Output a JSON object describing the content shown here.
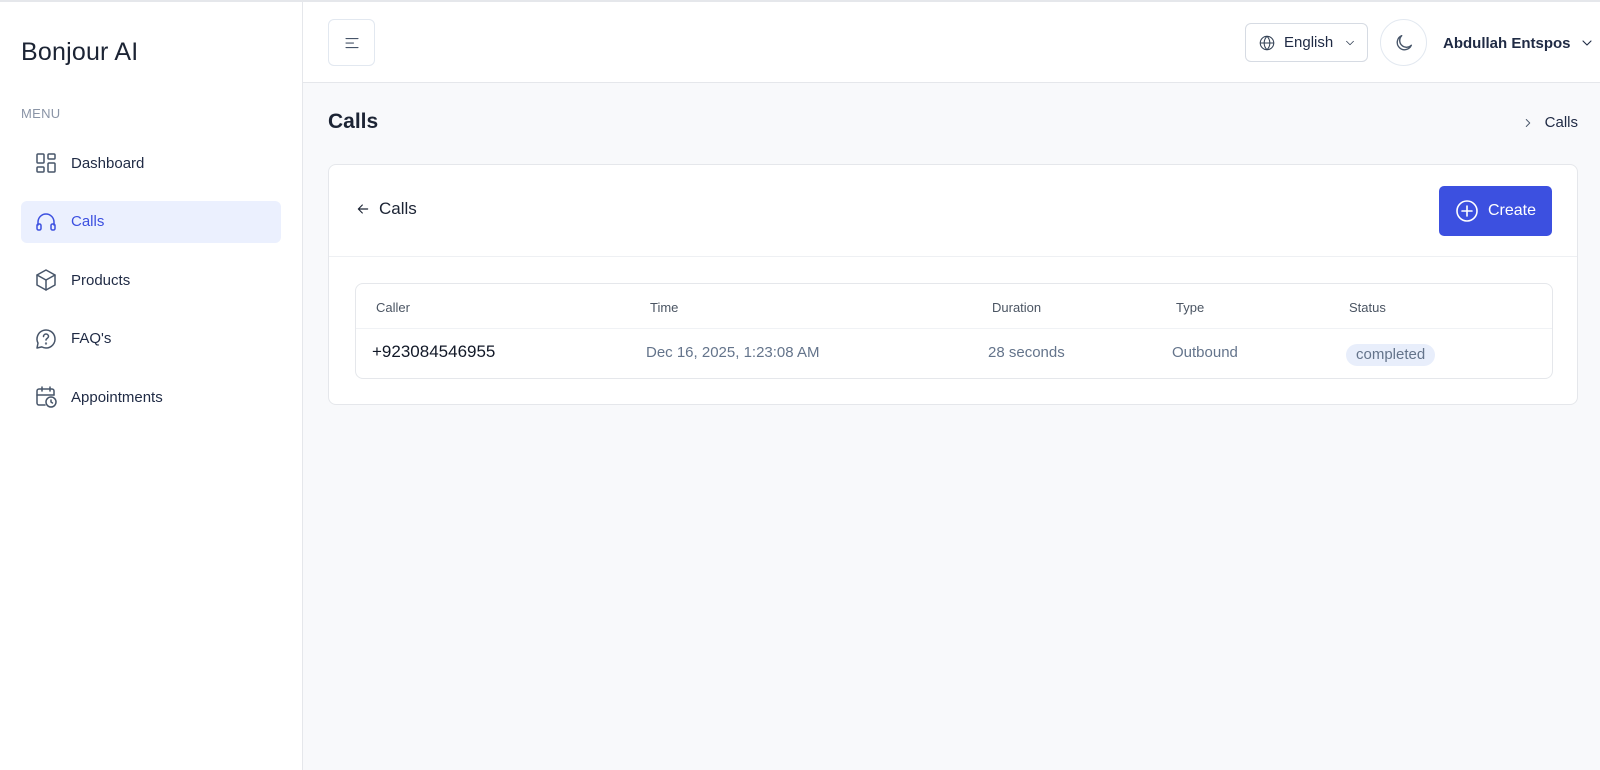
{
  "sidebar": {
    "brand": "Bonjour AI",
    "menu_label": "MENU",
    "items": [
      {
        "label": "Dashboard",
        "icon": "dashboard-grid-icon"
      },
      {
        "label": "Calls",
        "icon": "headset-icon",
        "active": true
      },
      {
        "label": "Products",
        "icon": "box-icon"
      },
      {
        "label": "FAQ's",
        "icon": "help-circle-icon"
      },
      {
        "label": "Appointments",
        "icon": "calendar-clock-icon"
      }
    ]
  },
  "header": {
    "language": "English",
    "user_name": "Abdullah Entspos"
  },
  "page": {
    "title": "Calls",
    "breadcrumb": "Calls"
  },
  "card": {
    "back_label": "Calls",
    "create_label": "Create"
  },
  "table": {
    "columns": [
      "Caller",
      "Time",
      "Duration",
      "Type",
      "Status"
    ],
    "rows": [
      {
        "caller": "+923084546955",
        "time": "Dec 16, 2025, 1:23:08 AM",
        "duration": "28 seconds",
        "type": "Outbound",
        "status": "completed"
      }
    ]
  },
  "colors": {
    "accent": "#3c50e0",
    "active_bg": "#ebf0fe",
    "badge_bg": "#e8eefb"
  }
}
